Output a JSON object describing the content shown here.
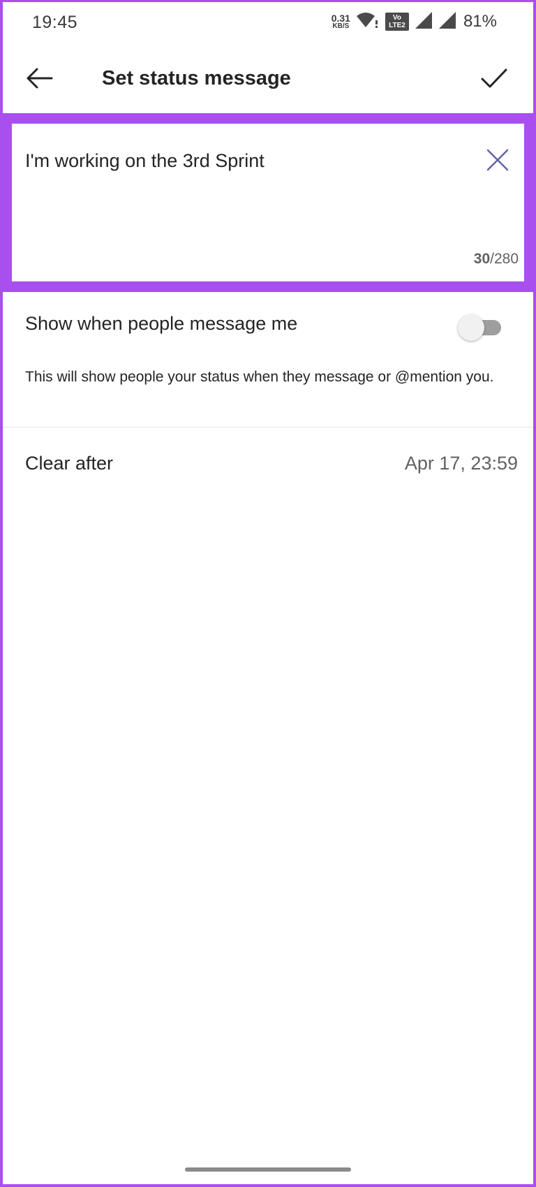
{
  "status_bar": {
    "time": "19:45",
    "net_speed_value": "0.31",
    "net_speed_unit": "KB/S",
    "volte_top": "Vo",
    "volte_bottom": "LTE2",
    "battery": "81%",
    "icons": [
      "wifi-icon",
      "volte-icon",
      "signal-icon",
      "signal-icon",
      "battery-text"
    ]
  },
  "app_bar": {
    "title": "Set status message",
    "back_icon": "arrow-left-icon",
    "confirm_icon": "checkmark-icon"
  },
  "status_input": {
    "value": "I'm working on the 3rd Sprint",
    "clear_icon": "close-icon",
    "char_count": "30",
    "char_limit": "/280"
  },
  "settings": {
    "show_when_messaged": {
      "label": "Show when people message me",
      "enabled": false,
      "helper": "This will show people your status when they message or @mention you."
    },
    "clear_after": {
      "label": "Clear after",
      "value": "Apr 17, 23:59"
    }
  },
  "colors": {
    "highlight": "#a94ff0",
    "accent": "#6264a7",
    "text_primary": "#242424",
    "text_secondary": "#616161"
  }
}
